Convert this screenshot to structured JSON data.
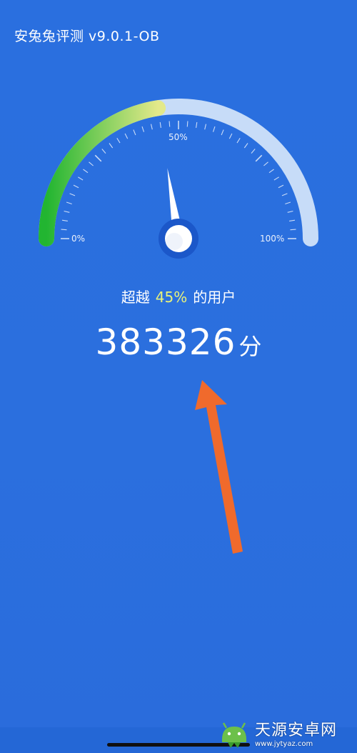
{
  "app": {
    "title": "安兔兔评测 v9.0.1-OB"
  },
  "gauge": {
    "percentile": 0.45,
    "labels": {
      "min": "0%",
      "mid": "50%",
      "max": "100%"
    },
    "colors": {
      "start": "#22b531",
      "mid": "#e3e98a",
      "track": "#c7dcf8",
      "needle": "#ffffff",
      "hub_ring": "#1b57c9"
    }
  },
  "result": {
    "prefix": "超越",
    "percent": "45%",
    "suffix": "的用户",
    "score": "383326",
    "score_unit": "分"
  },
  "annotation": {
    "arrow_color": "#f06a2c"
  },
  "watermark": {
    "name": "天源安卓网",
    "url": "www.jytyaz.com"
  }
}
